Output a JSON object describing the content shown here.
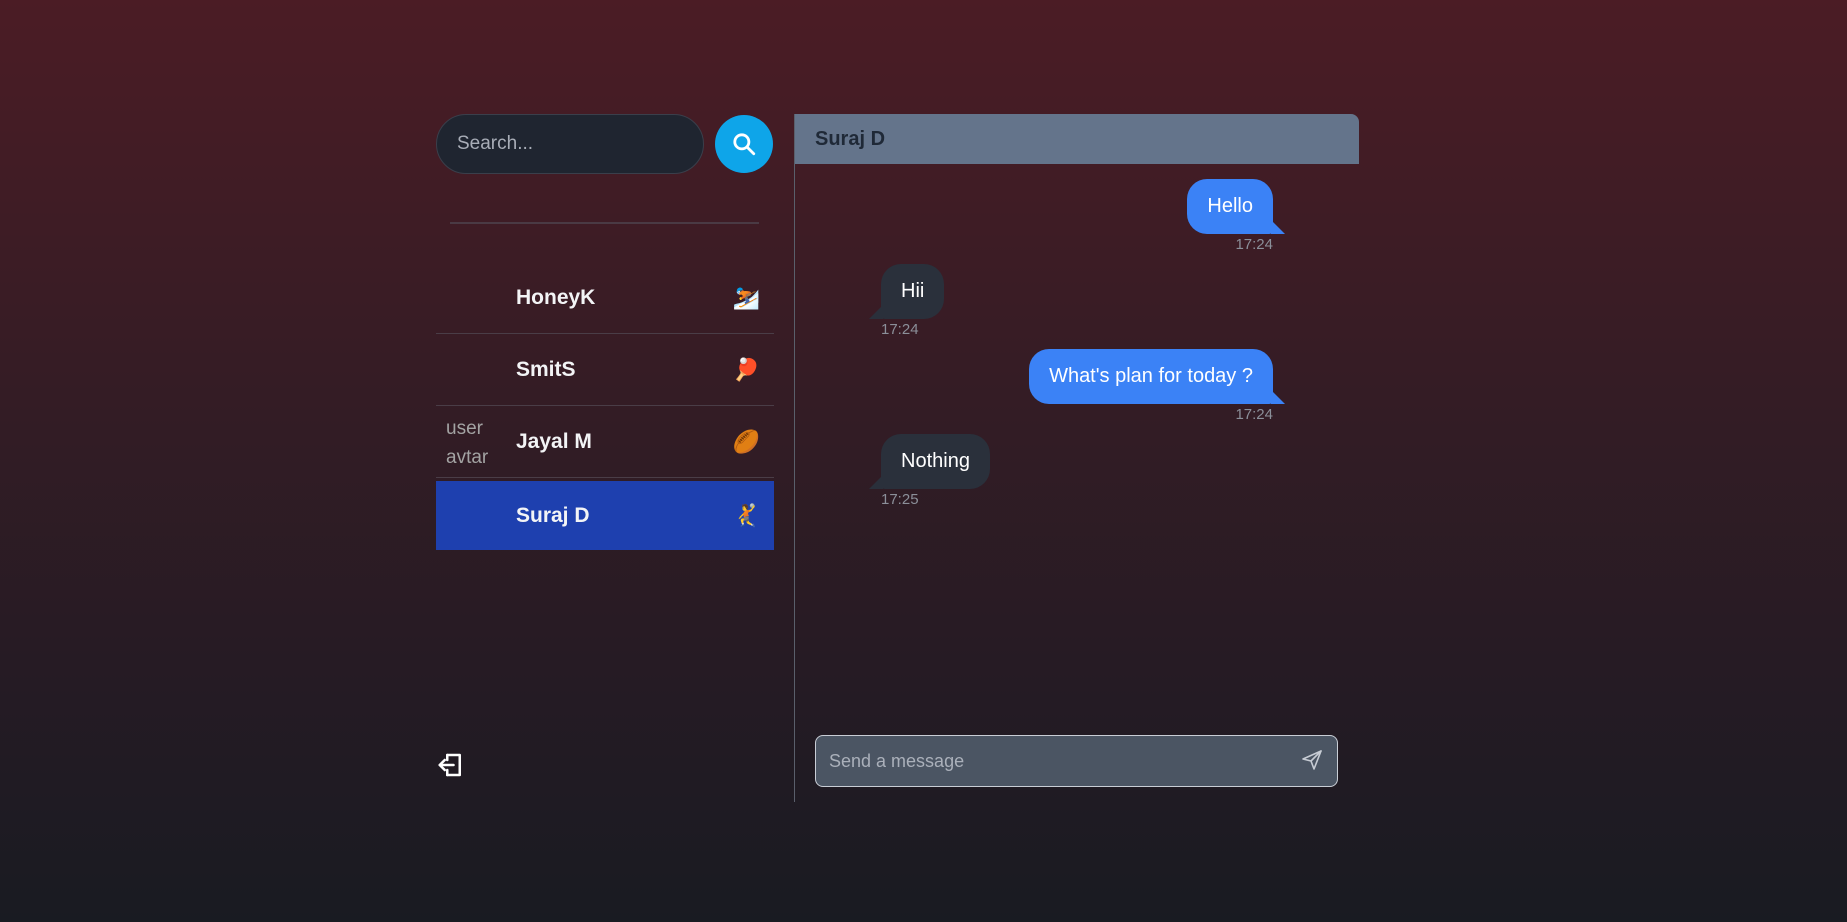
{
  "sidebar": {
    "search": {
      "placeholder": "Search..."
    },
    "contacts": [
      {
        "name": "HoneyK",
        "emoji": "⛷️",
        "avatar_alt": ""
      },
      {
        "name": "SmitS",
        "emoji": "🏓",
        "avatar_alt": ""
      },
      {
        "name": "Jayal M",
        "emoji": "🏉",
        "avatar_alt": "user avtar"
      },
      {
        "name": "Suraj D",
        "emoji": "🤾",
        "avatar_alt": "",
        "active": true
      }
    ]
  },
  "chat": {
    "header_name": "Suraj D",
    "messages": [
      {
        "text": "Hello",
        "time": "17:24",
        "direction": "sent"
      },
      {
        "text": "Hii",
        "time": "17:24",
        "direction": "received"
      },
      {
        "text": "What's plan for today ?",
        "time": "17:24",
        "direction": "sent"
      },
      {
        "text": "Nothing",
        "time": "17:25",
        "direction": "received"
      }
    ],
    "composer": {
      "placeholder": "Send a message"
    }
  },
  "colors": {
    "accent": "#0ea5e9",
    "active_contact": "#1e40af",
    "sent_bubble": "#3b82f6",
    "received_bubble": "#2a303b",
    "header": "#64748b"
  },
  "icons": {
    "search": "search-icon",
    "logout": "logout-icon",
    "send": "send-icon"
  }
}
